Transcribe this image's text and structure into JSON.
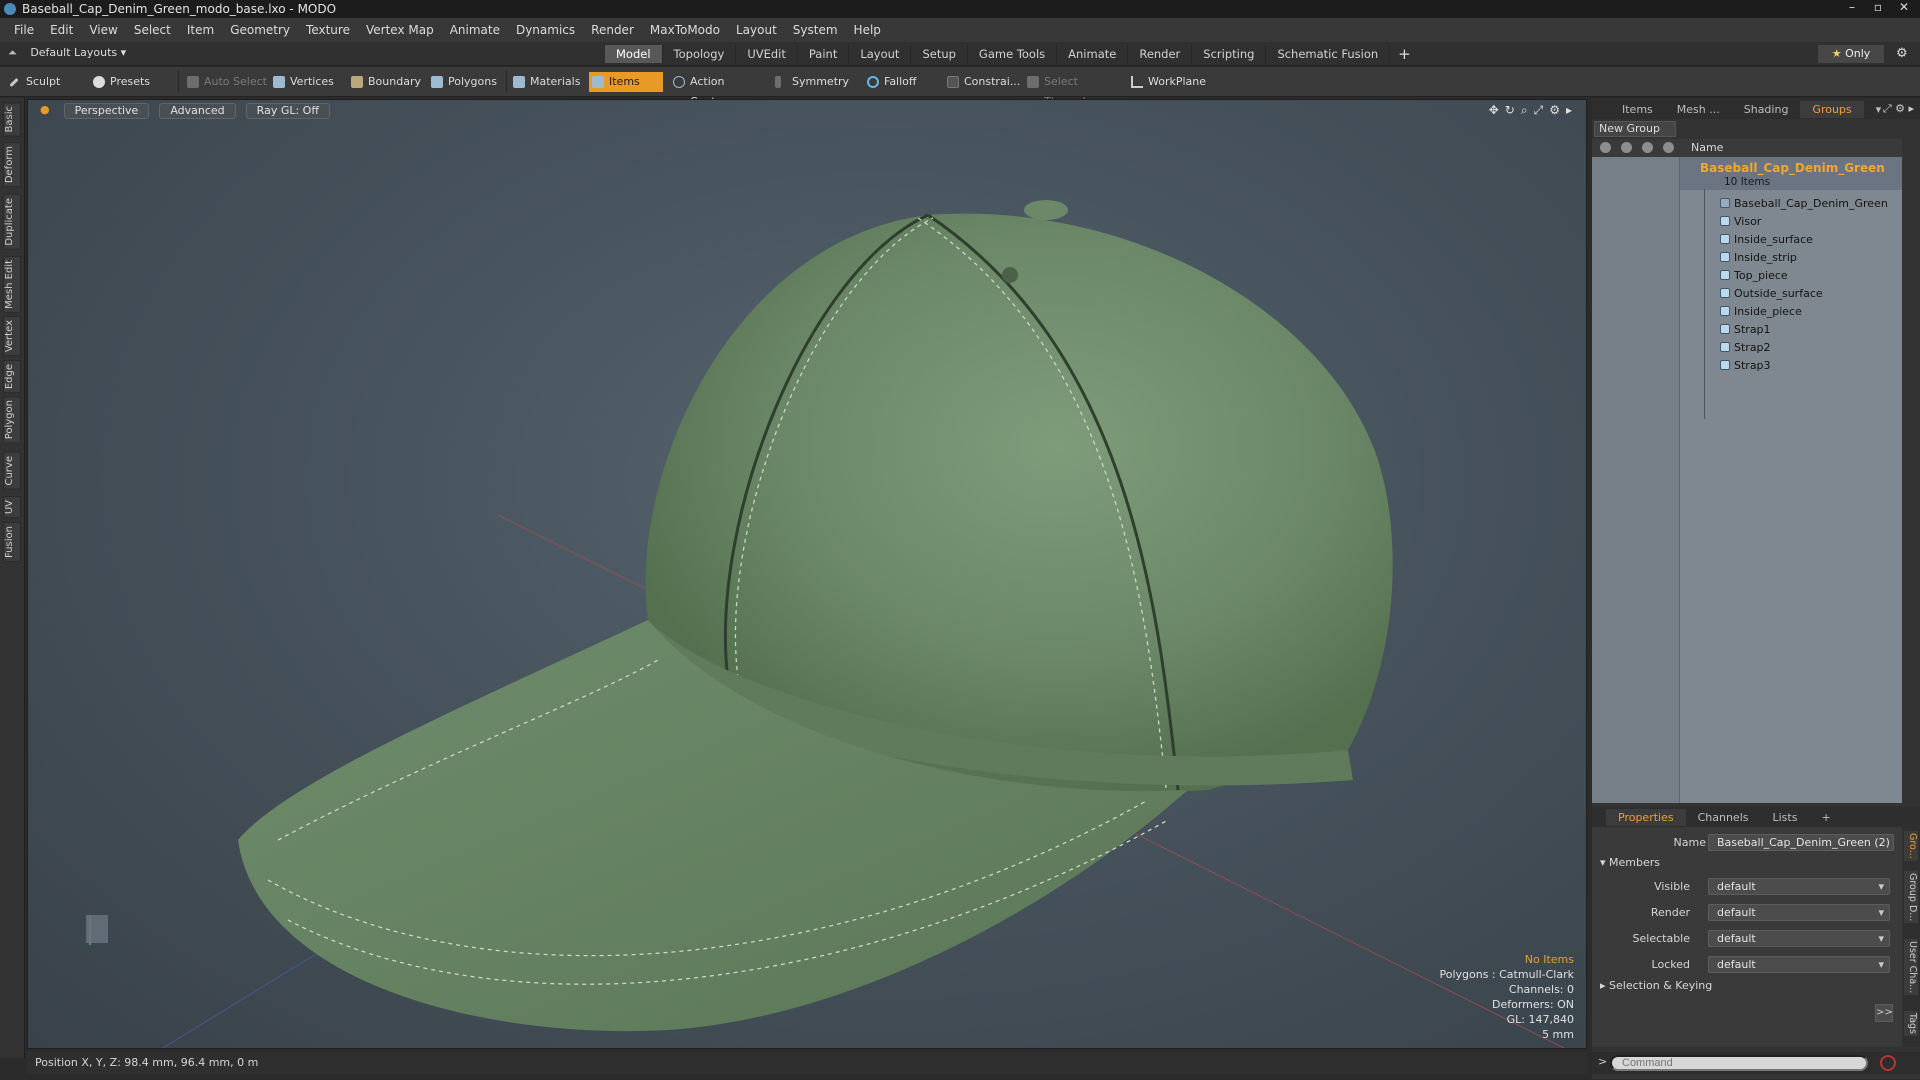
{
  "window": {
    "title": "Baseball_Cap_Denim_Green_modo_base.lxo - MODO",
    "controls": [
      "–",
      "▫",
      "✕"
    ]
  },
  "menu": [
    "File",
    "Edit",
    "View",
    "Select",
    "Item",
    "Geometry",
    "Texture",
    "Vertex Map",
    "Animate",
    "Dynamics",
    "Render",
    "MaxToModo",
    "Layout",
    "System",
    "Help"
  ],
  "layouts": {
    "label": "Default Layouts",
    "tabs": [
      "Model",
      "Topology",
      "UVEdit",
      "Paint",
      "Layout",
      "Setup",
      "Game Tools",
      "Animate",
      "Render",
      "Scripting",
      "Schematic Fusion"
    ],
    "active_tab": "Model",
    "only_label": "Only"
  },
  "toolbar": {
    "sculpt": "Sculpt",
    "presets": "Presets",
    "auto_select": "Auto Select",
    "vertices": "Vertices",
    "boundary": "Boundary",
    "polygons": "Polygons",
    "materials": "Materials",
    "items": "Items",
    "action_center": "Action Center",
    "symmetry": "Symmetry",
    "falloff": "Falloff",
    "constraints": "Constrai...",
    "select_through": "Select Through",
    "workplane": "WorkPlane"
  },
  "left_tabs": [
    "Basic",
    "Deform",
    "Duplicate",
    "Mesh Edit",
    "Vertex",
    "Edge",
    "Polygon",
    "Curve",
    "UV",
    "Fusion"
  ],
  "viewport": {
    "view_mode": "Perspective",
    "shading": "Advanced",
    "raygl": "Ray GL: Off",
    "info": {
      "selection": "No Items",
      "polygons": "Polygons : Catmull-Clark",
      "channels": "Channels: 0",
      "deformers": "Deformers: ON",
      "gl": "GL: 147,840",
      "scale": "5 mm"
    }
  },
  "status": {
    "position": "Position X, Y, Z:  98.4 mm, 96.4 mm, 0 m"
  },
  "right_panel": {
    "tabs": [
      "Items",
      "Mesh ...",
      "Shading",
      "Groups"
    ],
    "active_tab": "Groups",
    "new_group": "New Group",
    "column_name": "Name",
    "group": {
      "name": "Baseball_Cap_Denim_Green",
      "count": "10 Items"
    },
    "items": [
      "Baseball_Cap_Denim_Green",
      "Visor",
      "Inside_surface",
      "Inside_strip",
      "Top_piece",
      "Outside_surface",
      "Inside_piece",
      "Strap1",
      "Strap2",
      "Strap3"
    ]
  },
  "properties": {
    "tabs": [
      "Properties",
      "Channels",
      "Lists"
    ],
    "active_tab": "Properties",
    "name_label": "Name",
    "name_value": "Baseball_Cap_Denim_Green (2)",
    "members_section": "Members",
    "rows": [
      {
        "label": "Visible",
        "value": "default"
      },
      {
        "label": "Render",
        "value": "default"
      },
      {
        "label": "Selectable",
        "value": "default"
      },
      {
        "label": "Locked",
        "value": "default"
      }
    ],
    "selection_section": "Selection & Keying",
    "side_tabs": [
      "Gro...",
      "Group D...",
      "User Cha...",
      "Tags"
    ]
  },
  "command": {
    "placeholder": "Command"
  },
  "colors": {
    "accent": "#e89a24",
    "cap_green": "#6f8b6c",
    "viewport_bg": "#48545e",
    "tree_bg": "#7f8891"
  }
}
